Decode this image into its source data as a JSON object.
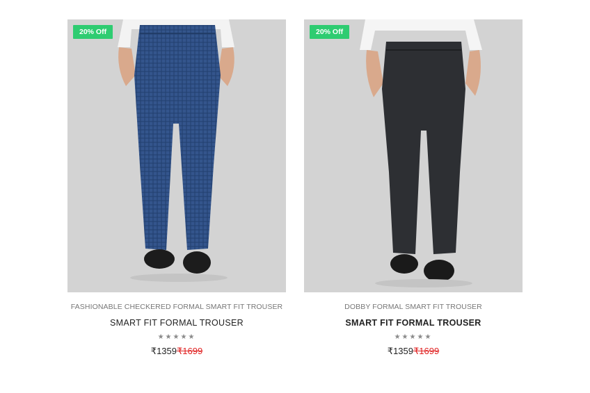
{
  "products": [
    {
      "badge": "20% Off",
      "category": "FASHIONABLE CHECKERED FORMAL SMART FIT TROUSER",
      "name": "SMART FIT FORMAL TROUSER",
      "rating_display": "★★★★★",
      "rating": 0,
      "price": "₹1359",
      "old_price": "₹1699",
      "trouser_color": "#34558c",
      "image_alt": "Blue checkered formal trouser"
    },
    {
      "badge": "20% Off",
      "category": "DOBBY FORMAL SMART FIT TROUSER",
      "name": "SMART FIT FORMAL TROUSER",
      "rating_display": "★★★★★",
      "rating": 0,
      "price": "₹1359",
      "old_price": "₹1699",
      "trouser_color": "#2d2f33",
      "image_alt": "Dark grey dobby formal trouser"
    }
  ],
  "colors": {
    "badge": "#2ecc71",
    "old_price": "#e02020",
    "image_bg": "#d3d3d3"
  }
}
